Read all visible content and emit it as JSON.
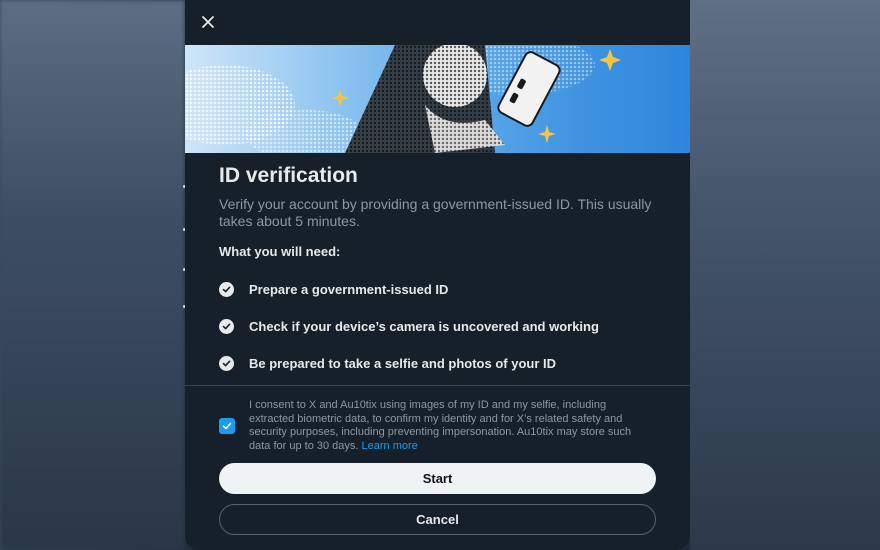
{
  "dialog": {
    "title": "ID verification",
    "subtitle": "Verify your account by providing a government-issued ID. This usually takes about 5 minutes.",
    "need_heading": "What you will need:",
    "requirements": [
      {
        "label": "Prepare a government-issued ID",
        "icon": "check-circle-icon"
      },
      {
        "label": "Check if your device’s camera is uncovered and working",
        "icon": "check-circle-icon"
      },
      {
        "label": "Be prepared to take a selfie and photos of your ID",
        "icon": "check-circle-icon"
      }
    ],
    "consent": {
      "checked": true,
      "text": "I consent to X and Au10tix using images of my ID and my selfie, including extracted biometric data, to confirm my identity and for X’s related safety and security purposes, including preventing impersonation. Au10tix may store such data for up to 30 days.",
      "link_label": "Learn more"
    },
    "buttons": {
      "start_label": "Start",
      "cancel_label": "Cancel"
    }
  },
  "colors": {
    "modal_background": "#15202b",
    "accent": "#1d9bf0",
    "primary_text": "#e7e9ea",
    "secondary_text": "#8b98a5"
  },
  "icons": {
    "close": "close-icon",
    "check": "check-circle-icon",
    "checkbox": "checkbox-checked-icon"
  }
}
